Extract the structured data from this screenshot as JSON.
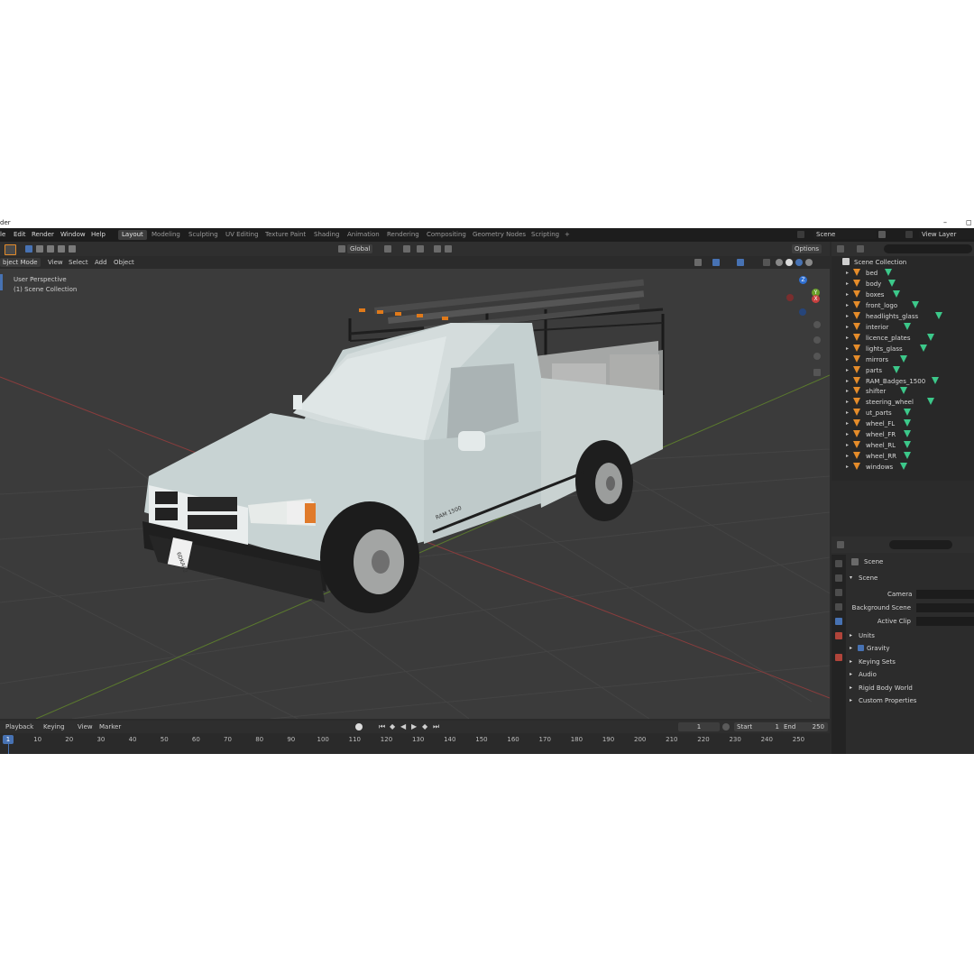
{
  "app": {
    "title_fragment": "der",
    "window_controls": {
      "minimize": "–",
      "maximize": "◻"
    }
  },
  "menu": {
    "items": [
      "le",
      "Edit",
      "Render",
      "Window",
      "Help"
    ]
  },
  "workspaces": [
    "Layout",
    "Modeling",
    "Sculpting",
    "UV Editing",
    "Texture Paint",
    "Shading",
    "Animation",
    "Rendering",
    "Compositing",
    "Geometry Nodes",
    "Scripting"
  ],
  "workspace_add": "+",
  "scene_selector": {
    "scene": "Scene",
    "view_layer": "View Layer"
  },
  "viewport_header": {
    "mode": "bject Mode",
    "menus": [
      "View",
      "Select",
      "Add",
      "Object"
    ],
    "transform_orientation": "Global",
    "options": "Options"
  },
  "viewport": {
    "perspective_label": "User Perspective",
    "collection_label": "(1) Scene Collection",
    "gizmo": {
      "z": "Z",
      "y": "Y",
      "x": "X"
    }
  },
  "outliner": {
    "root": "Scene Collection",
    "items": [
      "bed",
      "body",
      "boxes",
      "front_logo",
      "headlights_glass",
      "interior",
      "licence_plates",
      "lights_glass",
      "mirrors",
      "parts",
      "RAM_Badges_1500",
      "shifter",
      "steering_wheel",
      "ut_parts",
      "wheel_FL",
      "wheel_FR",
      "wheel_RL",
      "wheel_RR",
      "windows"
    ]
  },
  "properties": {
    "header": "Scene",
    "section": "Scene",
    "fields": [
      {
        "label": "Camera"
      },
      {
        "label": "Background Scene"
      },
      {
        "label": "Active Clip"
      }
    ],
    "panels": [
      "Units",
      "Gravity",
      "Keying Sets",
      "Audio",
      "Rigid Body World",
      "Custom Properties"
    ],
    "gravity_checked": true
  },
  "timeline": {
    "menus": [
      "Playback",
      "Keying",
      "View",
      "Marker"
    ],
    "current_frame": "1",
    "start_label": "Start",
    "start": "1",
    "end_label": "End",
    "end": "250",
    "cursor_frame": "1",
    "ticks": [
      "10",
      "20",
      "30",
      "40",
      "50",
      "60",
      "70",
      "80",
      "90",
      "100",
      "110",
      "120",
      "130",
      "140",
      "150",
      "160",
      "170",
      "180",
      "190",
      "200",
      "210",
      "220",
      "230",
      "240",
      "250"
    ]
  },
  "truck": {
    "plate_text": "6DKA02",
    "badge_text": "RAM 1500"
  },
  "colors": {
    "accent": "#4772b3",
    "object_orange": "#e58c2a",
    "mesh_green": "#3cc88a",
    "viewport_bg": "#3b3b3b"
  }
}
